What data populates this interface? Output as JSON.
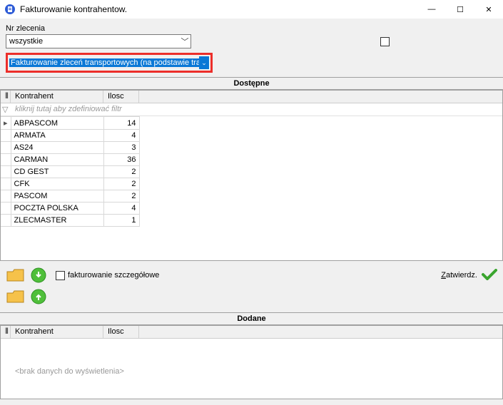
{
  "window": {
    "title": "Fakturowanie kontrahentow.",
    "minimize": "—",
    "maximize": "☐",
    "close": "✕"
  },
  "form": {
    "order_no_label": "Nr zlecenia",
    "order_no_value": "wszystkie",
    "invoice_mode": "Fakturowanie zleceń transportowych (na podstawie trans"
  },
  "sections": {
    "available": "Dostępne",
    "added": "Dodane"
  },
  "grid_top": {
    "col_kontrahent": "Kontrahent",
    "col_ilosc": "Ilosc",
    "filter_hint": "kliknij tutaj aby zdefiniować filtr",
    "filter_glyph": "▽",
    "col_glyph": "⦀",
    "row_glyph": "▸",
    "rows": [
      {
        "k": "ABPASCOM",
        "i": 14
      },
      {
        "k": "ARMATA",
        "i": 4
      },
      {
        "k": "AS24",
        "i": 3
      },
      {
        "k": "CARMAN",
        "i": 36
      },
      {
        "k": "CD GEST",
        "i": 2
      },
      {
        "k": "CFK",
        "i": 2
      },
      {
        "k": "PASCOM",
        "i": 2
      },
      {
        "k": "POCZTA POLSKA",
        "i": 4
      },
      {
        "k": "ZLECMASTER",
        "i": 1
      }
    ]
  },
  "midbar": {
    "detail_invoice": "fakturowanie szczegółowe",
    "confirm": "Zatwierdz.",
    "confirm_underline": "Z"
  },
  "grid_bot": {
    "col_kontrahent": "Kontrahent",
    "col_ilosc": "Ilosc",
    "no_data": "<brak danych do wyświetlenia>"
  }
}
